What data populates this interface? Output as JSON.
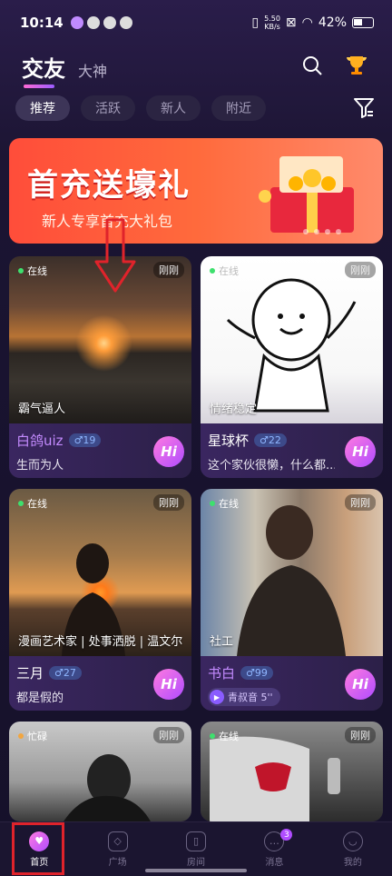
{
  "status_bar": {
    "time": "10:14",
    "net_speed_top": "5.50",
    "net_speed_bottom": "KB/s",
    "battery": "42%"
  },
  "header": {
    "tab_active": "交友",
    "tab_inactive": "大神"
  },
  "filters": [
    "推荐",
    "活跃",
    "新人",
    "附近"
  ],
  "banner": {
    "title": "首充送壕礼",
    "subtitle": "新人专享首充大礼包"
  },
  "cards": [
    {
      "status": "在线",
      "time": "刚刚",
      "caption": "霸气逼人",
      "name": "白鸽uiz",
      "age": "♂19",
      "bio": "生而为人",
      "hi": "Hi"
    },
    {
      "status": "在线",
      "time": "刚刚",
      "caption": "情绪稳定",
      "name": "星球杯",
      "age": "♂22",
      "bio": "这个家伙很懒，什么都...",
      "hi": "Hi"
    },
    {
      "status": "在线",
      "time": "刚刚",
      "caption": "漫画艺术家 | 处事洒脱 | 温文尔",
      "name": "三月",
      "age": "♂27",
      "bio": "都是假的",
      "hi": "Hi"
    },
    {
      "status": "在线",
      "time": "刚刚",
      "caption": "社工",
      "name": "书白",
      "age": "♂99",
      "voice": "青叔音 5''",
      "hi": "Hi"
    },
    {
      "status": "忙碌",
      "time": "刚刚"
    },
    {
      "status": "在线",
      "time": "刚刚"
    }
  ],
  "bottom_nav": [
    {
      "label": "首页"
    },
    {
      "label": "广场"
    },
    {
      "label": "房间"
    },
    {
      "label": "消息",
      "badge": "3"
    },
    {
      "label": "我的"
    }
  ],
  "colors": {
    "accent": "#b04cff",
    "highlight": "#e0232b"
  }
}
